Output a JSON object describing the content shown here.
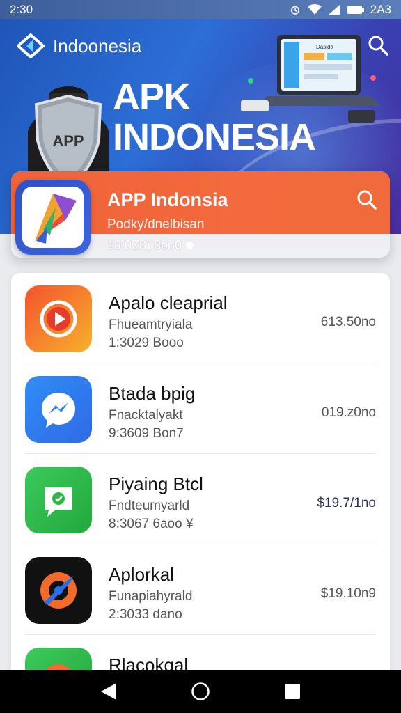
{
  "status_bar": {
    "time": "2:30",
    "right_text": "2A3",
    "icons": [
      "alarm-icon",
      "wifi-icon",
      "signal-icon",
      "battery-icon"
    ]
  },
  "hero": {
    "brand": "Indoonesia",
    "title_line1": "APK",
    "title_line2": "INDONESIA",
    "shield_text": "APP",
    "laptop_screen_text": "Dasida",
    "colors": {
      "bg_start": "#1f55b8",
      "bg_end": "#4a2da0"
    }
  },
  "featured": {
    "title": "APP Indonsia",
    "subtitle": "Podky/dnelbisan",
    "meta": "19:0Z8) 8on0",
    "accent": "#f0623a"
  },
  "apps": [
    {
      "name": "Apalo cleaprial",
      "developer": "Fhueamtryiala",
      "meta": "1:3029 Booo",
      "price": "613.50no",
      "icon": "play-icon",
      "icon_color": "#f3532d"
    },
    {
      "name": "Btada bpig",
      "developer": "Fnacktalyakt",
      "meta": "9:3609 Bon7",
      "price": "019.z0no",
      "icon": "messenger-icon",
      "icon_color": "#2f7df0"
    },
    {
      "name": "Piyaing Btcl",
      "developer": "Fndteumyarld",
      "meta": "8:3067 6aoo ¥",
      "price": "$19.7/1no",
      "icon": "chat-bubble-icon",
      "icon_color": "#2eb846"
    },
    {
      "name": "Aplorkal",
      "developer": "Funapiahyrald",
      "meta": "2:3033 dano",
      "price": "$19.10n9",
      "icon": "orbit-icon",
      "icon_color": "#111111"
    },
    {
      "name": "Rlacokgal",
      "developer": "",
      "meta": "",
      "price": "",
      "icon": "chrome-like-icon",
      "icon_color": "#2eb846"
    }
  ],
  "nav": {
    "buttons": [
      "back-icon",
      "home-icon",
      "recents-icon"
    ]
  }
}
